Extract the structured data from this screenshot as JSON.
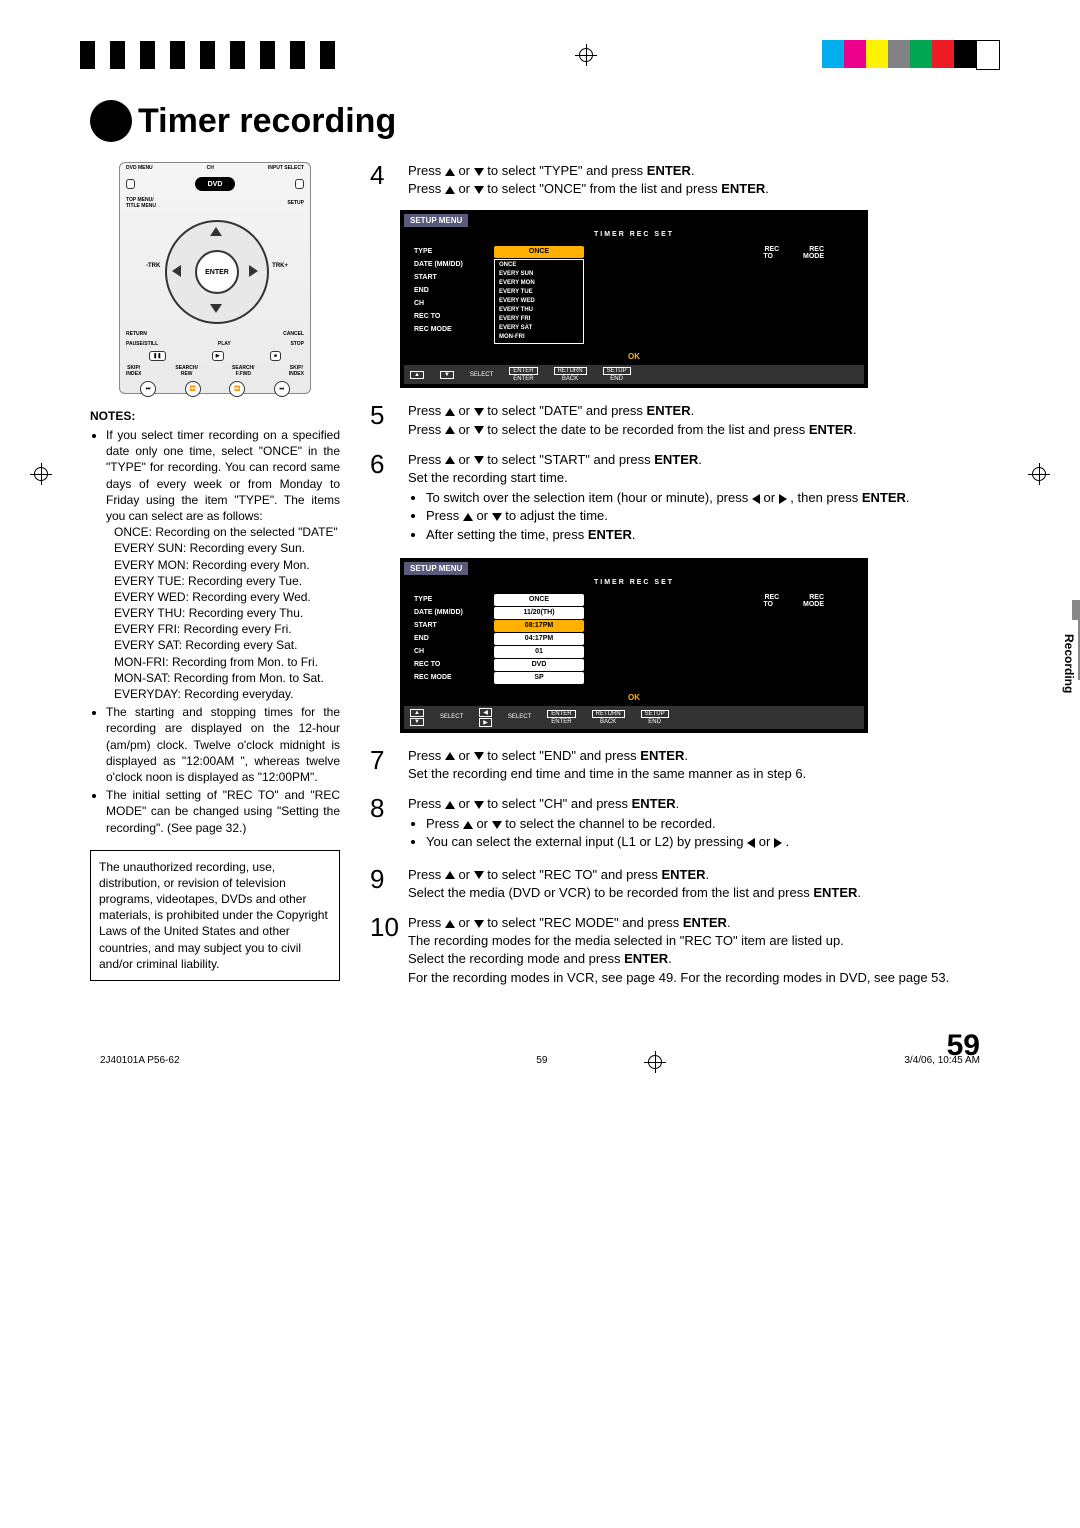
{
  "crop_colors": [
    "#00aeef",
    "#ec008c",
    "#fff200",
    "#808285",
    "#00a651",
    "#ed1c24",
    "#000000",
    "#ffffff"
  ],
  "title": "Timer recording",
  "remote": {
    "dvd_menu": "DVD MENU",
    "ch": "CH",
    "input_select": "INPUT SELECT",
    "top_menu": "TOP MENU/\nTITLE MENU",
    "setup": "SETUP",
    "dvd": "DVD",
    "trk_minus": "-TRK",
    "enter": "ENTER",
    "trk_plus": "TRK+",
    "return": "RETURN",
    "cancel": "CANCEL",
    "pause": "PAUSE/STILL",
    "play": "PLAY",
    "stop": "STOP",
    "skip_r": "SKIP/\nINDEX",
    "rew": "SEARCH/\nREW",
    "ffwd": "SEARCH/\nF.FWD",
    "skip_f": "SKIP/\nINDEX"
  },
  "notes": {
    "heading": "NOTES:",
    "b1": "If you select timer recording on a specified date only one time, select \"ONCE\" in the \"TYPE\" for recording. You can record same days of every week or from Monday to Friday using the item \"TYPE\". The items you can select are as follows:",
    "types": [
      "ONCE: Recording on the selected \"DATE\"",
      "EVERY SUN: Recording every Sun.",
      "EVERY MON: Recording every Mon.",
      "EVERY TUE: Recording every Tue.",
      "EVERY WED: Recording every Wed.",
      "EVERY THU: Recording every Thu.",
      "EVERY FRI: Recording every Fri.",
      "EVERY SAT: Recording every Sat.",
      "MON-FRI: Recording from Mon. to Fri.",
      "MON-SAT: Recording from Mon. to Sat.",
      "EVERYDAY: Recording everyday."
    ],
    "b2": "The starting and stopping times for the recording are displayed on the 12-hour (am/pm) clock. Twelve o'clock midnight is displayed as \"12:00AM \", whereas twelve o'clock noon is displayed as \"12:00PM\".",
    "b3": "The initial setting of \"REC TO\" and \"REC MODE\" can be changed using \"Setting the recording\". (See page 32.)"
  },
  "legal": "The unauthorized recording, use, distribution, or revision of television programs, videotapes, DVDs and other materials, is prohibited under the Copyright Laws of the United States and other countries, and may subject you to civil and/or criminal liability.",
  "steps": {
    "s4a": "Press ▲ or ▼ to select \"TYPE\" and press ENTER.",
    "s4b": "Press ▲ or ▼ to select \"ONCE\" from the list and press ENTER.",
    "s5a": "Press ▲ or ▼ to select \"DATE\" and press ENTER.",
    "s5b": "Press ▲ or ▼ to select the date to be recorded from the list and press ENTER.",
    "s6a": "Press ▲ or ▼ to select \"START\" and press ENTER.",
    "s6b": "Set the recording start time.",
    "s6c": "To switch over the selection item (hour or minute), press ◀ or ▶ , then press ENTER.",
    "s6d": "Press ▲ or ▼ to adjust the time.",
    "s6e": "After setting the time, press ENTER.",
    "s7a": "Press ▲ or ▼ to select \"END\" and press ENTER.",
    "s7b": "Set the recording end time and time in the same manner as in step 6.",
    "s8a": "Press ▲ or ▼ to select \"CH\" and press ENTER.",
    "s8b": "Press ▲ or ▼ to select the channel to be recorded.",
    "s8c": "You can select the external input (L1 or L2) by pressing ◀ or ▶ .",
    "s9a": "Press ▲ or ▼ to select \"REC TO\" and press ENTER.",
    "s9b": "Select the media (DVD or VCR) to be recorded from the list and press ENTER.",
    "s10a": "Press ▲ or ▼ to select \"REC MODE\" and press ENTER.",
    "s10b": "The recording modes for the media selected in \"REC TO\" item are listed up.",
    "s10c": "Select the recording mode and press ENTER.",
    "s10d": "For the recording modes in VCR, see page 49. For the recording modes in DVD, see page 53."
  },
  "osd1": {
    "title": "SETUP MENU",
    "sub": "TIMER REC SET",
    "rec_to": "REC TO",
    "rec_mode_h": "REC MODE",
    "labels": [
      "TYPE",
      "DATE (MM/DD)",
      "START",
      "END",
      "CH",
      "REC TO",
      "REC MODE"
    ],
    "val_type": "ONCE",
    "dropdown": [
      "ONCE",
      "EVERY SUN",
      "EVERY MON",
      "EVERY TUE",
      "EVERY WED",
      "EVERY THU",
      "EVERY FRI",
      "EVERY SAT",
      "MON-FRI"
    ],
    "ok": "OK",
    "footer": [
      "SELECT",
      "ENTER",
      "ENTER",
      "RETURN",
      "BACK",
      "SETUP",
      "END"
    ]
  },
  "osd2": {
    "title": "SETUP MENU",
    "sub": "TIMER REC SET",
    "labels": [
      "TYPE",
      "DATE (MM/DD)",
      "START",
      "END",
      "CH",
      "REC TO",
      "REC MODE"
    ],
    "vals": [
      "ONCE",
      "11/20(TH)",
      "08:17PM",
      "04:17PM",
      "01",
      "DVD",
      "SP"
    ],
    "ok": "OK",
    "footer": [
      "SELECT",
      "SELECT",
      "ENTER",
      "ENTER",
      "RETURN",
      "BACK",
      "SETUP",
      "END"
    ]
  },
  "side_tab": "Recording",
  "page_number": "59",
  "meta_left": "2J40101A P56-62",
  "meta_mid": "59",
  "meta_right": "3/4/06, 10:45 AM"
}
